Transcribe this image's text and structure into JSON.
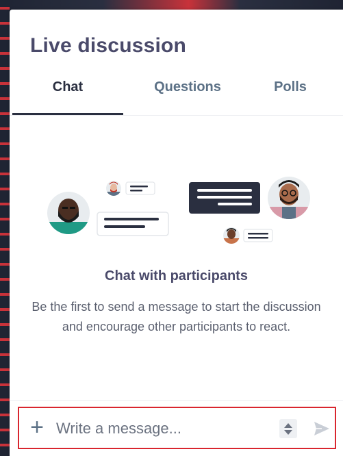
{
  "panel": {
    "title": "Live discussion"
  },
  "tabs": [
    {
      "label": "Chat",
      "active": true
    },
    {
      "label": "Questions",
      "active": false
    },
    {
      "label": "Polls",
      "active": false
    }
  ],
  "empty_state": {
    "title": "Chat with participants",
    "description": "Be the first to send a message to start the discussion and encourage other participants to react."
  },
  "composer": {
    "placeholder": "Write a message...",
    "add_icon": "plus-icon",
    "stepper_icon": "stepper-icon",
    "send_icon": "send-icon"
  },
  "colors": {
    "title": "#4a4a6a",
    "tab_inactive": "#5c7186",
    "tab_active": "#2a2f40",
    "highlight_border": "#d9262f",
    "bubble_dark": "#2a2f40"
  }
}
